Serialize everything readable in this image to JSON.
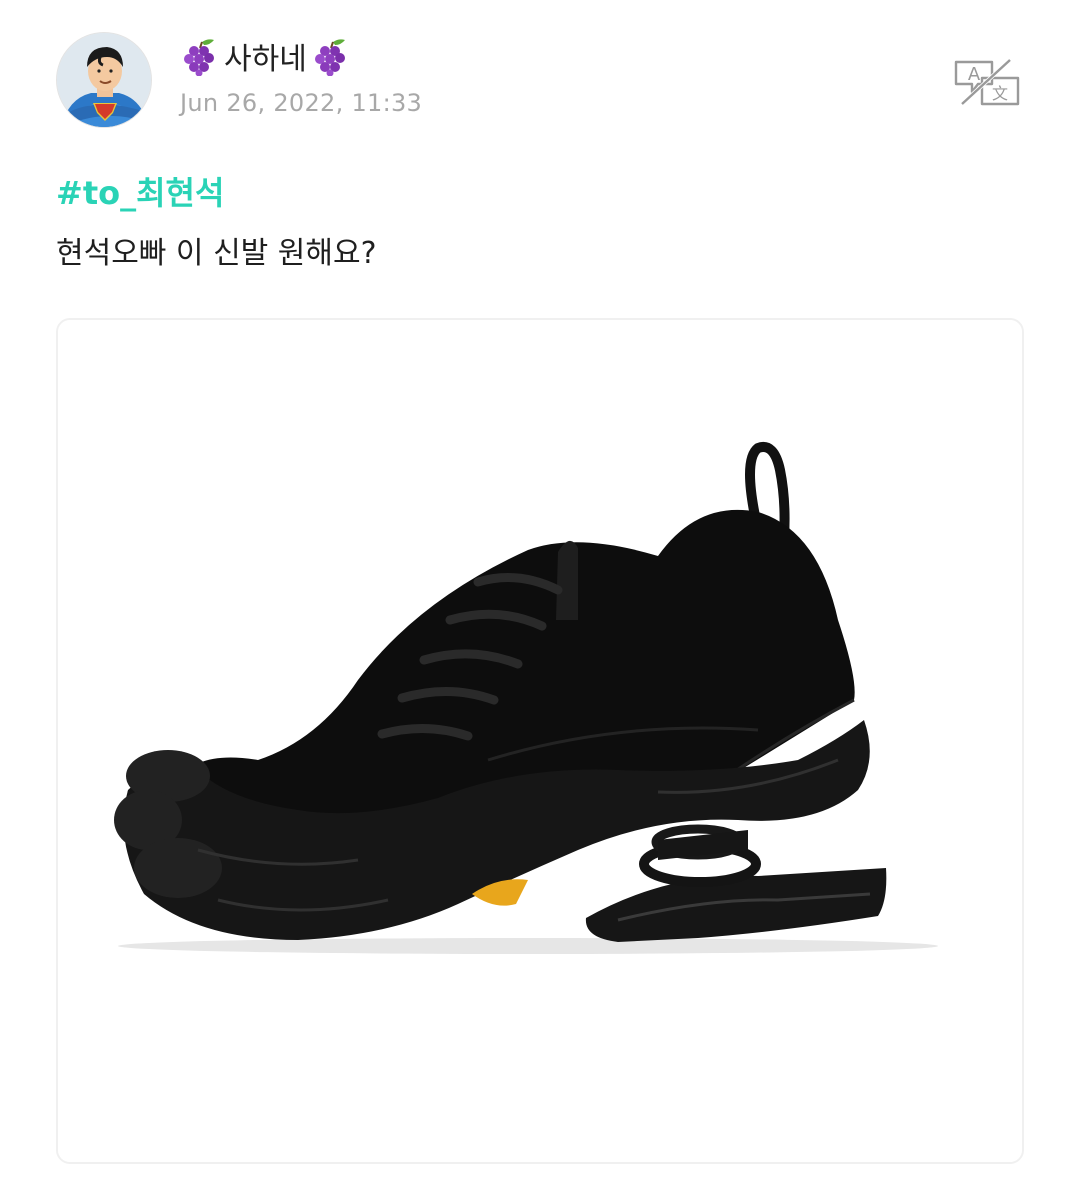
{
  "post": {
    "author_name": "사하네",
    "author_emoji": "grape-icon",
    "timestamp": "Jun 26, 2022, 11:33",
    "hashtag": "#to_최현석",
    "body": "현석오빠 이 신발 원해요?"
  },
  "icons": {
    "avatar": "superhero-avatar-icon",
    "translate": "translate-icon"
  },
  "image": {
    "subject": "shoe-photo"
  },
  "colors": {
    "hashtag": "#2ad3b6",
    "timestamp": "#a8a8a8",
    "text": "#1f1f1f"
  }
}
